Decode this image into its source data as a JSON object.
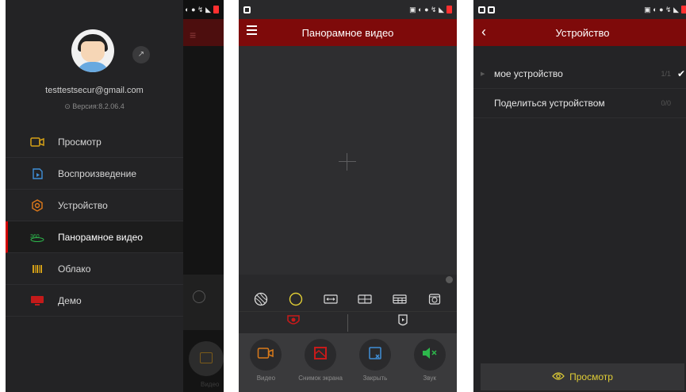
{
  "drawer": {
    "email": "testtestsecur@gmail.com",
    "version": "Версия:8.2.06.4",
    "items": [
      {
        "label": "Просмотр",
        "icon": "camera-icon",
        "color": "#d4a017"
      },
      {
        "label": "Воспроизведение",
        "icon": "playback-icon",
        "color": "#3f8fd8"
      },
      {
        "label": "Устройство",
        "icon": "gear-icon",
        "color": "#e07a1a"
      },
      {
        "label": "Панорамное видео",
        "icon": "panorama-360-icon",
        "color": "#2db84c"
      },
      {
        "label": "Облако",
        "icon": "cloud-barcode-icon",
        "color": "#d4a017"
      },
      {
        "label": "Демо",
        "icon": "demo-monitor-icon",
        "color": "#d02020"
      }
    ],
    "active_index": 3
  },
  "panorama": {
    "title": "Панорамное видео",
    "modes": [
      "fisheye-mode-icon",
      "circle-mode-icon",
      "stretch-mode-icon",
      "quad-split-icon",
      "multi-split-icon",
      "cylinder-mode-icon"
    ],
    "active_mode": 1,
    "tabs": [
      "mount-icon",
      "cruise-icon"
    ],
    "actions": [
      {
        "label": "Видео",
        "icon": "record-video-icon",
        "color": "#d97a1a"
      },
      {
        "label": "Снимок экрана",
        "icon": "snapshot-icon",
        "color": "#c81a1a"
      },
      {
        "label": "Закрыть",
        "icon": "close-stream-icon",
        "color": "#3f8fd8"
      },
      {
        "label": "Звук",
        "icon": "mute-sound-icon",
        "color": "#2db84c"
      }
    ]
  },
  "device": {
    "title": "Устройство",
    "rows": [
      {
        "name": "мое устройство",
        "count": "1/1",
        "checked": true
      },
      {
        "name": "Поделиться устройством",
        "count": "0/0",
        "checked": false
      }
    ],
    "bottom_button": "Просмотр"
  },
  "colors": {
    "header": "#7e0a0a",
    "accent_yellow": "#e0cd35",
    "active_bar": "#d00000"
  }
}
